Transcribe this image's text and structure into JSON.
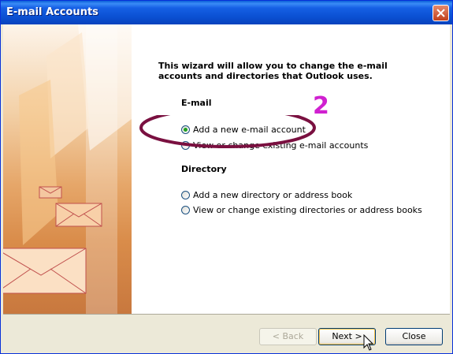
{
  "window": {
    "title": "E-mail Accounts"
  },
  "intro": {
    "text": "This wizard will allow you to change the e-mail accounts and directories that Outlook uses."
  },
  "email_section": {
    "heading": "E-mail",
    "options": [
      {
        "label": "Add a new e-mail account",
        "selected": true
      },
      {
        "label": "View or change existing e-mail accounts",
        "selected": false
      }
    ]
  },
  "directory_section": {
    "heading": "Directory",
    "options": [
      {
        "label": "Add a new directory or address book",
        "selected": false
      },
      {
        "label": "View or change existing directories or address books",
        "selected": false
      }
    ]
  },
  "annotation": {
    "step_number": "2",
    "color": "#d020d0",
    "ellipse_color": "#7a1040"
  },
  "buttons": {
    "back": "< Back",
    "next": "Next >",
    "close": "Close"
  },
  "colors": {
    "title_bar": "#0a4fd1",
    "dialog_bg": "#ece9d8"
  }
}
